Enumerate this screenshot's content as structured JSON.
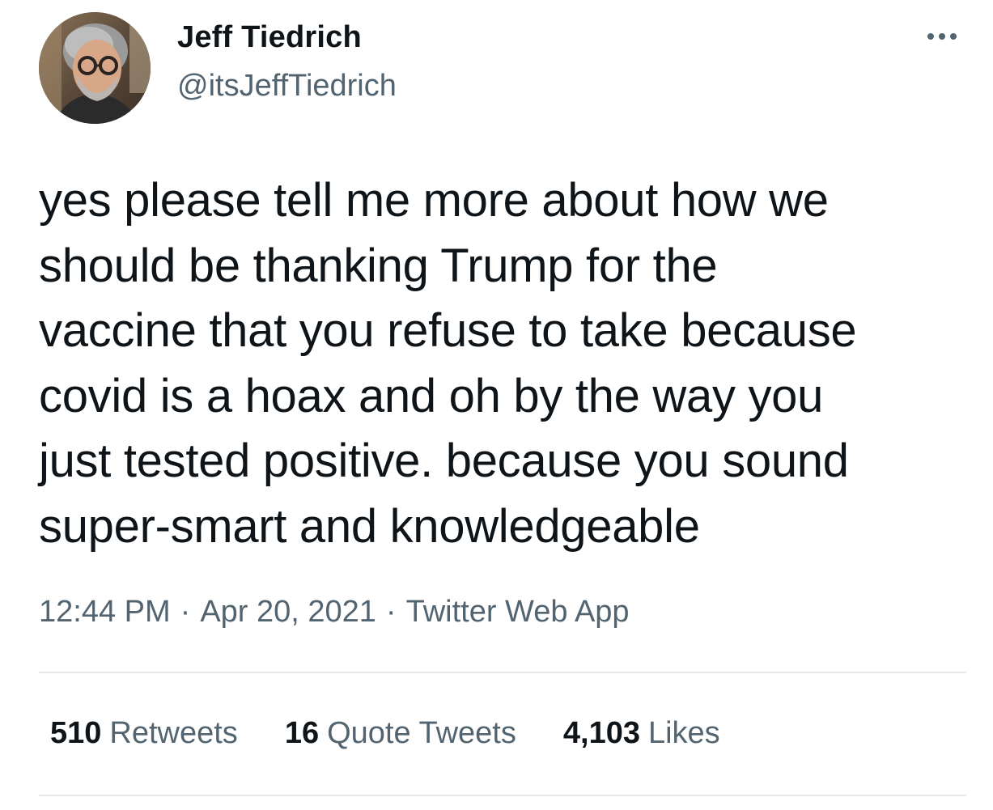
{
  "author": {
    "display_name": "Jeff Tiedrich",
    "handle": "@itsJeffTiedrich"
  },
  "tweet": {
    "lines": [
      "yes please tell me more about how we",
      "should be thanking Trump for the",
      "vaccine that you refuse to take because",
      "covid is a hoax and oh by the way you",
      "just tested positive. because you sound",
      "super-smart and knowledgeable"
    ]
  },
  "meta": {
    "time": "12:44 PM",
    "separator": "·",
    "date": "Apr 20, 2021",
    "source": "Twitter Web App"
  },
  "stats": {
    "retweets_count": "510",
    "retweets_label": "Retweets",
    "quotes_count": "16",
    "quotes_label": "Quote Tweets",
    "likes_count": "4,103",
    "likes_label": "Likes"
  },
  "icons": {
    "more": "more-horizontal-icon",
    "avatar": "profile-photo"
  },
  "colors": {
    "primary_text": "#0f1419",
    "secondary_text": "#536471",
    "divider": "#e6e9eb",
    "background": "#ffffff"
  }
}
